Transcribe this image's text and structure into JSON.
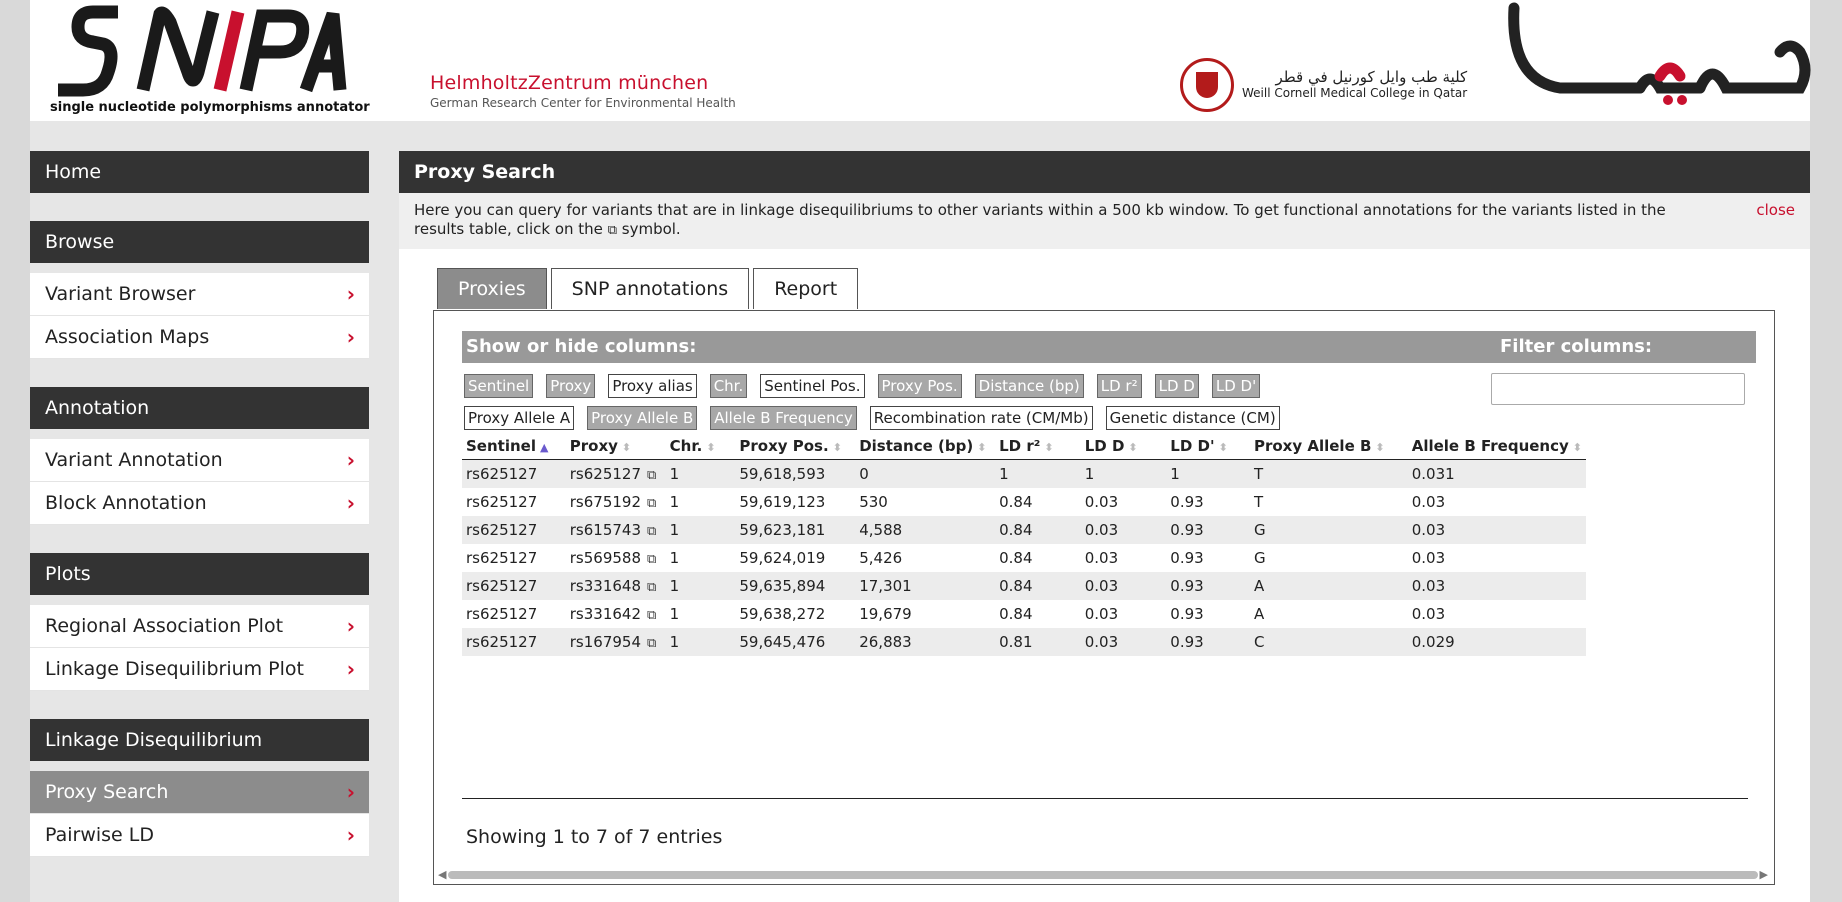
{
  "header": {
    "snipa_tagline": "single nucleotide polymorphisms annotator",
    "helmholtz_title": "HelmholtzZentrum münchen",
    "helmholtz_subtitle": "German Research Center for Environmental Health",
    "weill_arabic": "كلية طب وايل كورنيل في قطر",
    "weill_english": "Weill Cornell Medical College in Qatar"
  },
  "sidebar": {
    "home": "Home",
    "sections": [
      {
        "title": "Browse",
        "items": [
          "Variant Browser",
          "Association Maps"
        ]
      },
      {
        "title": "Annotation",
        "items": [
          "Variant Annotation",
          "Block Annotation"
        ]
      },
      {
        "title": "Plots",
        "items": [
          "Regional Association Plot",
          "Linkage Disequilibrium Plot"
        ]
      },
      {
        "title": "Linkage Disequilibrium",
        "items": [
          "Proxy Search",
          "Pairwise LD"
        ]
      }
    ],
    "active_item": "Proxy Search"
  },
  "main": {
    "title": "Proxy Search",
    "info_text_1": "Here you can query for variants that are in linkage disequilibriums to other variants within a 500 kb window. To get functional annotations for the variants listed in the results table, click on the",
    "info_text_2": "symbol.",
    "close_label": "close",
    "tabs": [
      "Proxies",
      "SNP annotations",
      "Report"
    ],
    "active_tab": "Proxies",
    "show_hide_label": "Show or hide columns:",
    "filter_label": "Filter columns:",
    "filter_value": "",
    "column_toggles": [
      {
        "label": "Sentinel",
        "on": true
      },
      {
        "label": "Proxy",
        "on": true
      },
      {
        "label": "Proxy alias",
        "on": false
      },
      {
        "label": "Chr.",
        "on": true
      },
      {
        "label": "Sentinel Pos.",
        "on": false
      },
      {
        "label": "Proxy Pos.",
        "on": true
      },
      {
        "label": "Distance (bp)",
        "on": true
      },
      {
        "label": "LD r²",
        "on": true
      },
      {
        "label": "LD D",
        "on": true
      },
      {
        "label": "LD D'",
        "on": true
      },
      {
        "label": "Proxy Allele A",
        "on": false
      },
      {
        "label": "Proxy Allele B",
        "on": true
      },
      {
        "label": "Allele B Frequency",
        "on": true
      },
      {
        "label": "Recombination rate (CM/Mb)",
        "on": false
      },
      {
        "label": "Genetic distance (CM)",
        "on": false
      }
    ],
    "table": {
      "headers": [
        "Sentinel",
        "Proxy",
        "Chr.",
        "Proxy Pos.",
        "Distance (bp)",
        "LD r²",
        "LD D",
        "LD D'",
        "Proxy Allele B",
        "Allele B Frequency"
      ],
      "rows": [
        [
          "rs625127",
          "rs625127",
          "1",
          "59,618,593",
          "0",
          "1",
          "1",
          "1",
          "T",
          "0.031"
        ],
        [
          "rs625127",
          "rs675192",
          "1",
          "59,619,123",
          "530",
          "0.84",
          "0.03",
          "0.93",
          "T",
          "0.03"
        ],
        [
          "rs625127",
          "rs615743",
          "1",
          "59,623,181",
          "4,588",
          "0.84",
          "0.03",
          "0.93",
          "G",
          "0.03"
        ],
        [
          "rs625127",
          "rs569588",
          "1",
          "59,624,019",
          "5,426",
          "0.84",
          "0.03",
          "0.93",
          "G",
          "0.03"
        ],
        [
          "rs625127",
          "rs331648",
          "1",
          "59,635,894",
          "17,301",
          "0.84",
          "0.03",
          "0.93",
          "A",
          "0.03"
        ],
        [
          "rs625127",
          "rs331642",
          "1",
          "59,638,272",
          "19,679",
          "0.84",
          "0.03",
          "0.93",
          "A",
          "0.03"
        ],
        [
          "rs625127",
          "rs167954",
          "1",
          "59,645,476",
          "26,883",
          "0.81",
          "0.03",
          "0.93",
          "C",
          "0.029"
        ]
      ]
    },
    "showing": "Showing 1 to 7 of 7 entries"
  },
  "colors": {
    "accent_red": "#c8102e",
    "dark_bar": "#333333",
    "grey_bar": "#999999"
  }
}
